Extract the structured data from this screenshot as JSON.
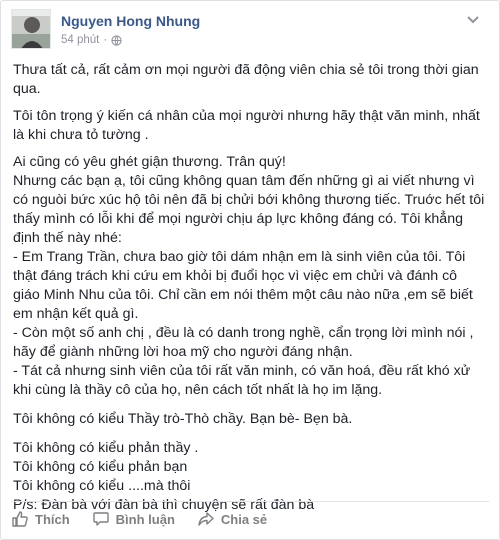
{
  "post": {
    "author": "Nguyen Hong Nhung",
    "time": "54 phút",
    "separator": "·",
    "privacy_icon": "globe-icon",
    "menu_icon": "chevron-down-icon",
    "paragraphs": [
      "Thưa tất cả, rất cảm ơn mọi người đã động viên chia sẻ tôi trong thời gian qua.",
      "Tôi tôn trọng ý kiến cá nhân của mọi người nhưng hãy thật văn minh, nhất là khi chưa tỏ tường .",
      "Ai cũng có yêu ghét giận thương. Trân quý!",
      "Nhưng các bạn ạ, tôi cũng không quan tâm đến những gì ai viết nhưng vì có nguòi bức xúc hộ tôi nên đã bị chửi bới không thương tiếc. Truớc hết tôi thấy mình có lỗi khi để mọi người chịu áp lực không đáng có. Tôi khẳng định thế này nhé:",
      "- Em Trang Trần, chưa bao giờ tôi dám nhận em là sinh viên của tôi. Tôi thật đáng trách khi cứu em khỏi bị đuổi học vì việc em chửi và đánh cô giáo Minh Nhu của tôi. Chỉ cần em nói thêm một câu nào nữa ,em sẽ biết em nhận kết quả gì.",
      "- Còn một số anh chị , đều là có danh trong nghề, cẩn trọng lời mình nói , hãy để giành những lời hoa mỹ cho người đáng nhận.",
      "- Tát cả nhưng sinh viên của tôi rất văn minh, có văn hoá, đều rất khó xử khi cùng là thầy cô của họ, nên cách tốt nhất là họ im lặng.",
      "Tôi không có kiểu Thầy trò-Thò chầy. Bạn bè- Bẹn bà.",
      "Tôi không có kiểu phản thầy .",
      "Tôi không có kiểu phản bạn",
      "Tôi không có kiểu ....mà thôi",
      "P/s: Đàn bà với đàn bà thì chuyện sẽ rất đàn bà"
    ]
  },
  "actions": {
    "like": {
      "label": "Thích",
      "icon": "thumbs-up-icon"
    },
    "comment": {
      "label": "Bình luận",
      "icon": "comment-icon"
    },
    "share": {
      "label": "Chia sẻ",
      "icon": "share-icon"
    }
  },
  "colors": {
    "author_link": "#365899",
    "meta_text": "#90949c",
    "action_text": "#7f7f7f",
    "body_text": "#1d2129"
  }
}
